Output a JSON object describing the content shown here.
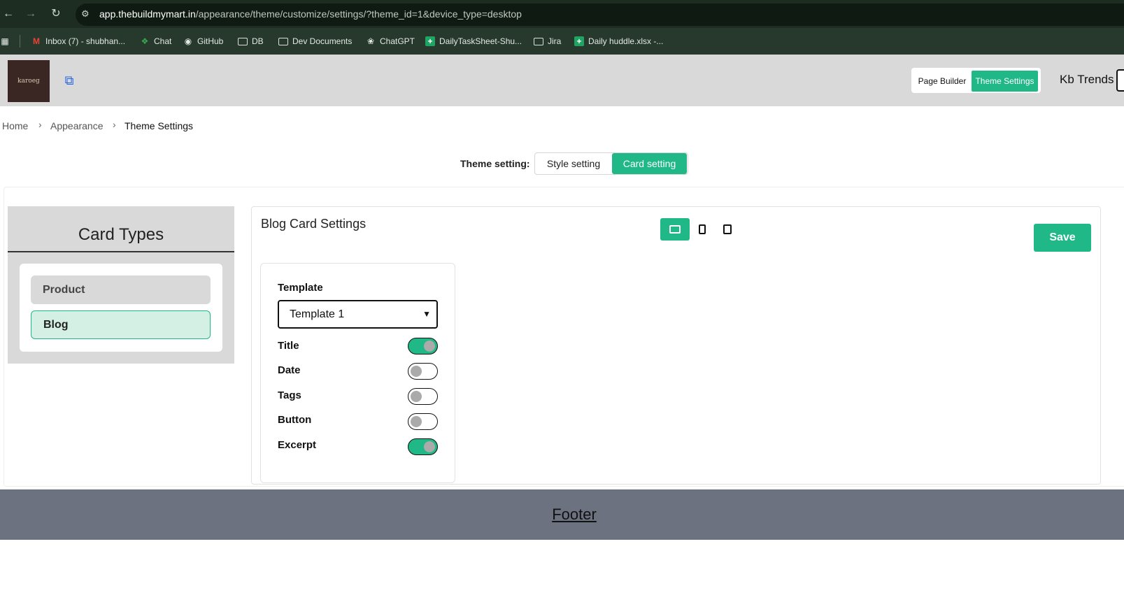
{
  "browser": {
    "url_host": "app.thebuildmymart.in",
    "url_path": "/appearance/theme/customize/settings/?theme_id=1&device_type=desktop",
    "bookmarks": [
      {
        "label": "Inbox (7) - shubhan...",
        "icon": "gmail-icon"
      },
      {
        "label": "Chat",
        "icon": "chat-icon"
      },
      {
        "label": "GitHub",
        "icon": "github-icon"
      },
      {
        "label": "DB",
        "icon": "folder-icon"
      },
      {
        "label": "Dev Documents",
        "icon": "folder-icon"
      },
      {
        "label": "ChatGPT",
        "icon": "chatgpt-icon"
      },
      {
        "label": "DailyTaskSheet-Shu...",
        "icon": "sheets-icon"
      },
      {
        "label": "Jira",
        "icon": "folder-icon"
      },
      {
        "label": "Daily huddle.xlsx -...",
        "icon": "sheets-icon"
      }
    ]
  },
  "header": {
    "logo_text": "karoeg",
    "page_builder_label": "Page Builder",
    "theme_settings_label": "Theme Settings",
    "store_name": "Kb Trends"
  },
  "breadcrumb": {
    "items": [
      "Home",
      "Appearance",
      "Theme Settings"
    ]
  },
  "theme_setting": {
    "label": "Theme setting:",
    "options": [
      "Style setting",
      "Card setting"
    ],
    "selected": "Card setting"
  },
  "card_types": {
    "title": "Card Types",
    "items": [
      "Product",
      "Blog"
    ],
    "selected": "Blog"
  },
  "main": {
    "title": "Blog Card Settings",
    "save_label": "Save",
    "devices": [
      "desktop-icon",
      "tablet-icon",
      "mobile-icon"
    ],
    "template_label": "Template",
    "template_value": "Template 1",
    "options": [
      {
        "label": "Title",
        "on": true
      },
      {
        "label": "Date",
        "on": false
      },
      {
        "label": "Tags",
        "on": false
      },
      {
        "label": "Button",
        "on": false
      },
      {
        "label": "Excerpt",
        "on": true
      }
    ]
  },
  "footer": {
    "text": "Footer"
  },
  "colors": {
    "accent": "#20b886",
    "header_bg": "#d9d9d9",
    "footer_bg": "#6c7280",
    "chrome_bg": "#1e2d22"
  }
}
